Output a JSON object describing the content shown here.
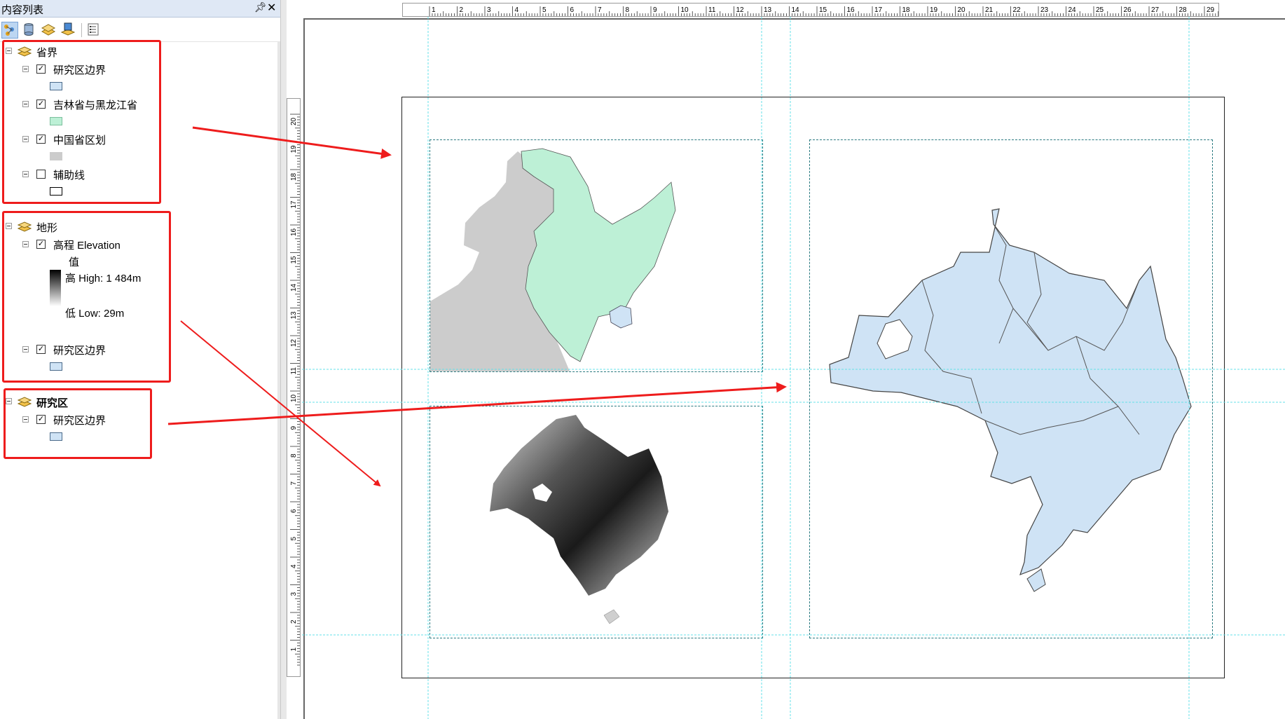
{
  "toc": {
    "title": "内容列表",
    "pin_glyph": "ᴘ",
    "close_glyph": "✕",
    "toolbar": [
      "list-by-drawing-order-icon",
      "list-by-source-icon",
      "list-by-visibility-icon",
      "list-by-selection-icon",
      "options-icon"
    ],
    "groups": [
      {
        "name": "省界",
        "layers": [
          {
            "name": "研究区边界",
            "checked": true,
            "swatch": "#cfe3f5"
          },
          {
            "name": "吉林省与黑龙江省",
            "checked": true,
            "swatch": "#bdf0d6"
          },
          {
            "name": "中国省区划",
            "checked": true,
            "swatch": "#cccccc"
          },
          {
            "name": "辅助线",
            "checked": false,
            "swatch": "#ffffff"
          }
        ]
      },
      {
        "name": "地形",
        "layers": [
          {
            "name": "高程 Elevation",
            "checked": true,
            "value_label": "值",
            "high": "高 High: 1 484m",
            "low": "低 Low: 29m"
          },
          {
            "name": "研究区边界",
            "checked": true,
            "swatch": "#cfe3f5"
          }
        ]
      },
      {
        "name": "研究区",
        "layers": [
          {
            "name": "研究区边界",
            "checked": true,
            "swatch": "#cfe3f5"
          }
        ]
      }
    ]
  },
  "rulers": {
    "horizontal": [
      "1",
      "2",
      "3",
      "4",
      "5",
      "6",
      "7",
      "8",
      "9",
      "10",
      "11",
      "12",
      "13",
      "14",
      "15",
      "16",
      "17",
      "18",
      "19",
      "20",
      "21",
      "22",
      "23",
      "24",
      "25",
      "26",
      "27",
      "28",
      "29"
    ],
    "vertical": [
      "20",
      "19",
      "18",
      "17",
      "16",
      "15",
      "14",
      "13",
      "12",
      "11",
      "10",
      "9",
      "8",
      "7",
      "6",
      "5",
      "4",
      "3",
      "2",
      "1"
    ]
  },
  "colors": {
    "annotation_red": "#ee1c1c",
    "guide_cyan": "#66e0e8",
    "province_gray": "#cccccc",
    "jl_hlj_green": "#bdf0d6",
    "study_area_blue": "#cfe3f5"
  }
}
